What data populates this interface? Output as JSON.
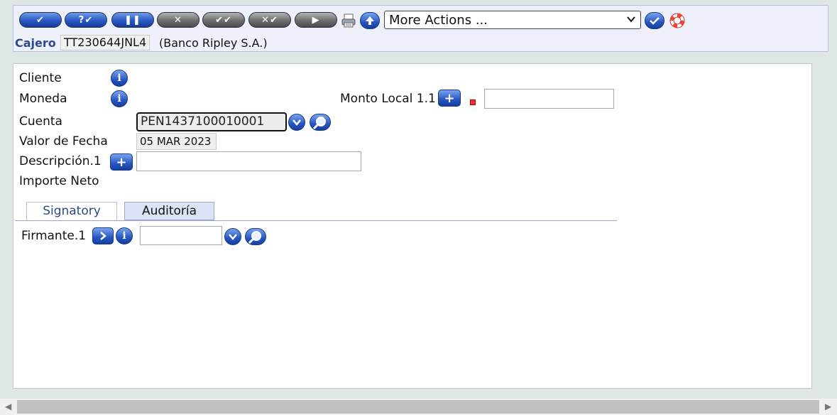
{
  "toolbar": {
    "buttons": [
      {
        "name": "commit",
        "glyph": "✔"
      },
      {
        "name": "validate",
        "glyph": "?✔"
      },
      {
        "name": "hold",
        "glyph": "❚❚"
      },
      {
        "name": "delete",
        "glyph": "✕"
      },
      {
        "name": "authorise",
        "glyph": "✔✔"
      },
      {
        "name": "reverse",
        "glyph": "✕✔"
      },
      {
        "name": "next",
        "glyph": "▶"
      }
    ],
    "more_actions_value": "More Actions ...",
    "icons": [
      "print-icon",
      "upload-icon",
      "confirm-icon",
      "help-lifebuoy-icon"
    ]
  },
  "header": {
    "cajero_label": "Cajero",
    "cajero_value": "TT230644JNL4",
    "bank_name": "(Banco Ripley S.A.)"
  },
  "form": {
    "cliente_label": "Cliente",
    "moneda_label": "Moneda",
    "monto_local_label": "Monto Local 1.1",
    "monto_local_value": "",
    "cuenta_label": "Cuenta",
    "cuenta_value": "PEN1437100010001",
    "valor_fecha_label": "Valor de Fecha",
    "valor_fecha_value": "05 MAR 2023",
    "descripcion_label": "Descripción.1",
    "descripcion_value": "",
    "importe_neto_label": "Importe Neto",
    "tabs": [
      {
        "label": "Signatory"
      },
      {
        "label": "Auditoría"
      }
    ],
    "firmante_label": "Firmante.1",
    "firmante_value": ""
  },
  "colors": {
    "accent_blue": "#2856c0",
    "label_blue": "#2f4a8a",
    "panel_bg": "#eef0fb",
    "required_red": "#e33333"
  }
}
